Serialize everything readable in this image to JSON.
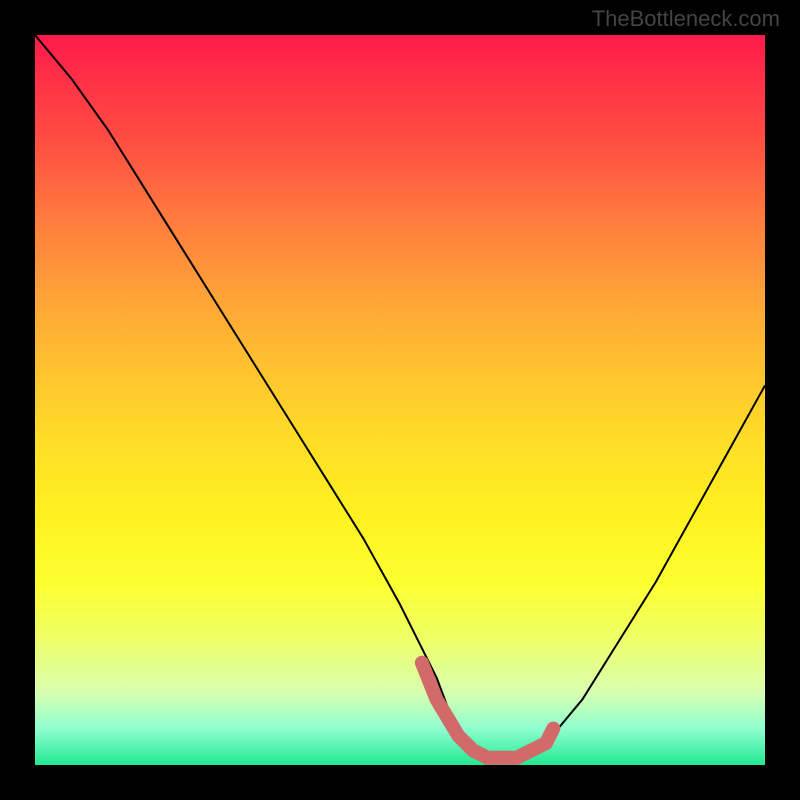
{
  "attribution": "TheBottleneck.com",
  "chart_data": {
    "type": "line",
    "title": "",
    "xlabel": "",
    "ylabel": "",
    "xlim": [
      0,
      100
    ],
    "ylim": [
      0,
      100
    ],
    "description": "Bottleneck curve over a red-to-green vertical gradient; a black V-shaped curve descends from top-left, reaches a flat minimum region (highlighted in salmon) roughly between x≈55 and x≈70, then rises toward the upper-right.",
    "series": [
      {
        "name": "curve",
        "color": "#000000",
        "x": [
          0,
          5,
          10,
          15,
          20,
          25,
          30,
          35,
          40,
          45,
          50,
          55,
          58,
          62,
          66,
          70,
          75,
          80,
          85,
          90,
          95,
          100
        ],
        "values": [
          100,
          94,
          87,
          79,
          71,
          63,
          55,
          47,
          39,
          31,
          22,
          12,
          4,
          1,
          1,
          3,
          9,
          17,
          25,
          34,
          43,
          52
        ]
      }
    ],
    "highlight": {
      "name": "optimal-range",
      "color": "#d16a68",
      "x": [
        53,
        55,
        58,
        60,
        62,
        64,
        66,
        68,
        70,
        71
      ],
      "values": [
        14,
        9,
        4,
        2,
        1,
        1,
        1,
        2,
        3,
        5
      ]
    },
    "gradient_stops": [
      {
        "pos": 0,
        "color": "#ff1a4a"
      },
      {
        "pos": 50,
        "color": "#ffdc28"
      },
      {
        "pos": 100,
        "color": "#20e890"
      }
    ]
  }
}
